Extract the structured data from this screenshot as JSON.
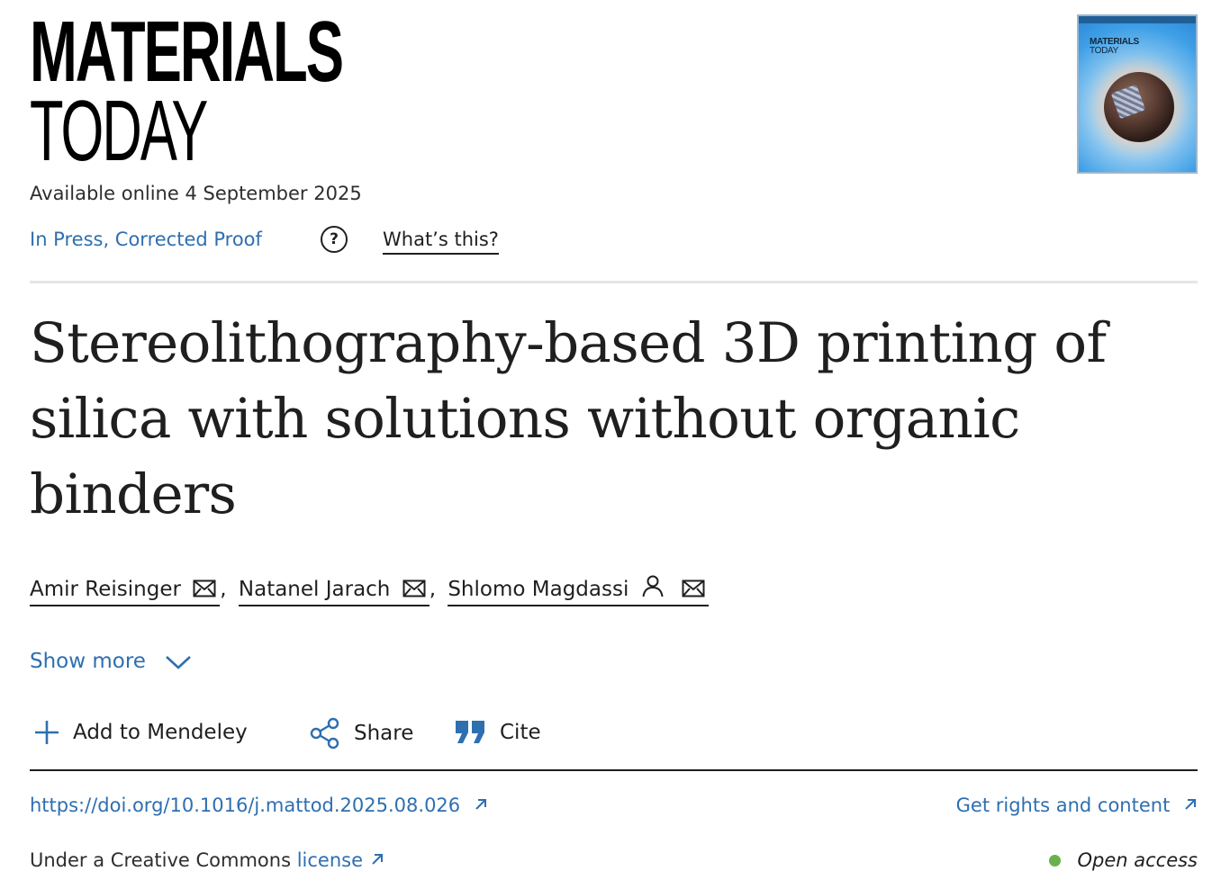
{
  "journal": {
    "logo_line1": "MATERIALS",
    "logo_line2": "TODAY",
    "cover_title_line1": "MATERIALS",
    "cover_title_line2": "TODAY"
  },
  "availability": "Available online 4 September 2025",
  "status": {
    "label": "In Press, Corrected Proof",
    "help_icon": "?",
    "whats_this": "What’s this?"
  },
  "article": {
    "title": "Stereolithography-based 3D printing of silica with solutions without organic binders"
  },
  "authors": [
    {
      "name": "Amir Reisinger"
    },
    {
      "name": "Natanel Jarach"
    },
    {
      "name": "Shlomo Magdassi"
    }
  ],
  "author_separator": ",",
  "show_more": "Show more",
  "actions": {
    "mendeley": "Add to Mendeley",
    "share": "Share",
    "cite": "Cite"
  },
  "links": {
    "doi": "https://doi.org/10.1016/j.mattod.2025.08.026",
    "rights": "Get rights and content"
  },
  "license": {
    "prefix": "Under a Creative Commons",
    "link": "license"
  },
  "open_access": "Open access",
  "colors": {
    "link_blue": "#2e6fb0",
    "open_access_dot": "#6ab04c",
    "text_dark": "#1f1f1f"
  },
  "icons": {
    "help": "question-circle-icon",
    "mail": "envelope-icon",
    "person": "person-icon",
    "chevron": "chevron-down-icon",
    "plus": "plus-icon",
    "share": "share-icon",
    "cite": "quote-icon",
    "external": "external-link-arrow-icon"
  }
}
